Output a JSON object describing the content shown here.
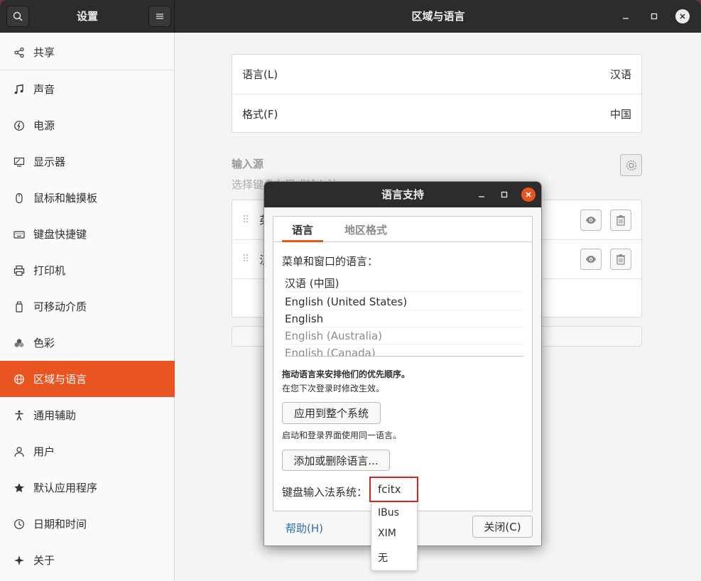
{
  "window": {
    "sidebar_title": "设置",
    "main_title": "区域与语言"
  },
  "icons": {
    "search": "search-icon",
    "menu": "hamburger-menu-icon",
    "minimize": "minimize-icon",
    "maximize": "maximize-icon",
    "close": "close-icon"
  },
  "sidebar": {
    "items": [
      {
        "label": "共享",
        "icon": "share-icon"
      },
      {
        "label": "声音",
        "icon": "music-note-icon"
      },
      {
        "label": "电源",
        "icon": "power-icon"
      },
      {
        "label": "显示器",
        "icon": "display-icon"
      },
      {
        "label": "鼠标和触摸板",
        "icon": "mouse-icon"
      },
      {
        "label": "键盘快捷键",
        "icon": "keyboard-icon"
      },
      {
        "label": "打印机",
        "icon": "printer-icon"
      },
      {
        "label": "可移动介质",
        "icon": "removable-media-icon"
      },
      {
        "label": "色彩",
        "icon": "color-icon"
      },
      {
        "label": "区域与语言",
        "icon": "globe-icon",
        "active": true
      },
      {
        "label": "通用辅助",
        "icon": "accessibility-icon"
      },
      {
        "label": "用户",
        "icon": "user-icon"
      },
      {
        "label": "默认应用程序",
        "icon": "star-icon"
      },
      {
        "label": "日期和时间",
        "icon": "clock-icon"
      },
      {
        "label": "关于",
        "icon": "sparkle-icon"
      }
    ],
    "accent": "#e95420"
  },
  "region": {
    "language_label": "语言(L)",
    "language_value": "汉语",
    "formats_label": "格式(F)",
    "formats_value": "中国",
    "input_sources_title": "输入源",
    "input_sources_subtitle": "选择键盘布局或输入法",
    "sources": [
      {
        "label": "英"
      },
      {
        "label": "汉"
      }
    ]
  },
  "dialog": {
    "title": "语言支持",
    "tabs": [
      {
        "label": "语言",
        "active": true
      },
      {
        "label": "地区格式",
        "active": false
      }
    ],
    "menu_lang_heading": "菜单和窗口的语言：",
    "languages": [
      {
        "label": "汉语 (中国)",
        "dim": false
      },
      {
        "label": "English (United States)",
        "dim": false
      },
      {
        "label": "English",
        "dim": false
      },
      {
        "label": "English (Australia)",
        "dim": true
      },
      {
        "label": "English (Canada)",
        "dim": true
      }
    ],
    "drag_hint": "拖动语言来安排他们的优先顺序。",
    "effect_hint": "在您下次登录时修改生效。",
    "apply_button": "应用到整个系统",
    "apply_hint": "启动和登录界面使用同一语言。",
    "add_remove_button": "添加或删除语言...",
    "im_label": "键盘输入法系统：",
    "im_selected": "fcitx",
    "im_options": [
      "IBus",
      "XIM",
      "无"
    ],
    "help_button": "帮助(H)",
    "close_button": "关闭(C)"
  }
}
